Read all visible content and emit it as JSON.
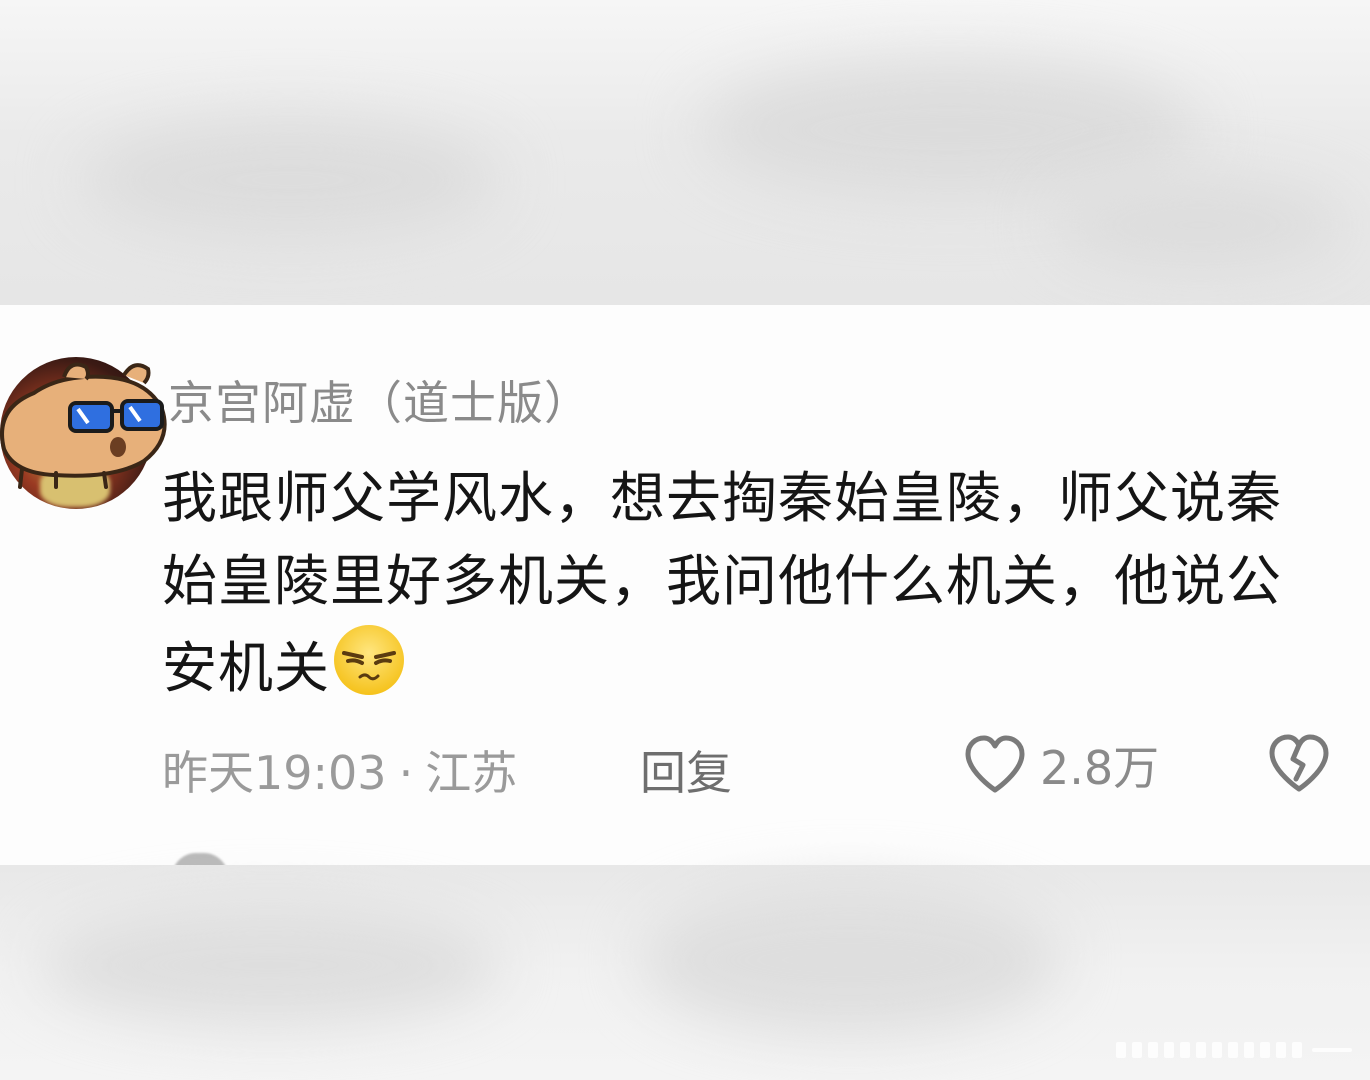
{
  "comment": {
    "username": "京宫阿虚（道士版）",
    "text": "我跟师父学风水，想去掏秦始皇陵，师父说秦始皇陵里好多机关，我问他什么机关，他说公安机关",
    "emoji_icon": "smirk-face-icon",
    "time": "昨天19:03",
    "separator": "·",
    "location": "江苏",
    "reply_label": "回复",
    "like_count": "2.8万",
    "like_icon": "heart-outline-icon",
    "dislike_icon": "broken-heart-icon"
  },
  "colors": {
    "username": "#8a8a8a",
    "text": "#151515",
    "meta": "#9a9a9a",
    "card_bg": "#fdfdfd"
  }
}
